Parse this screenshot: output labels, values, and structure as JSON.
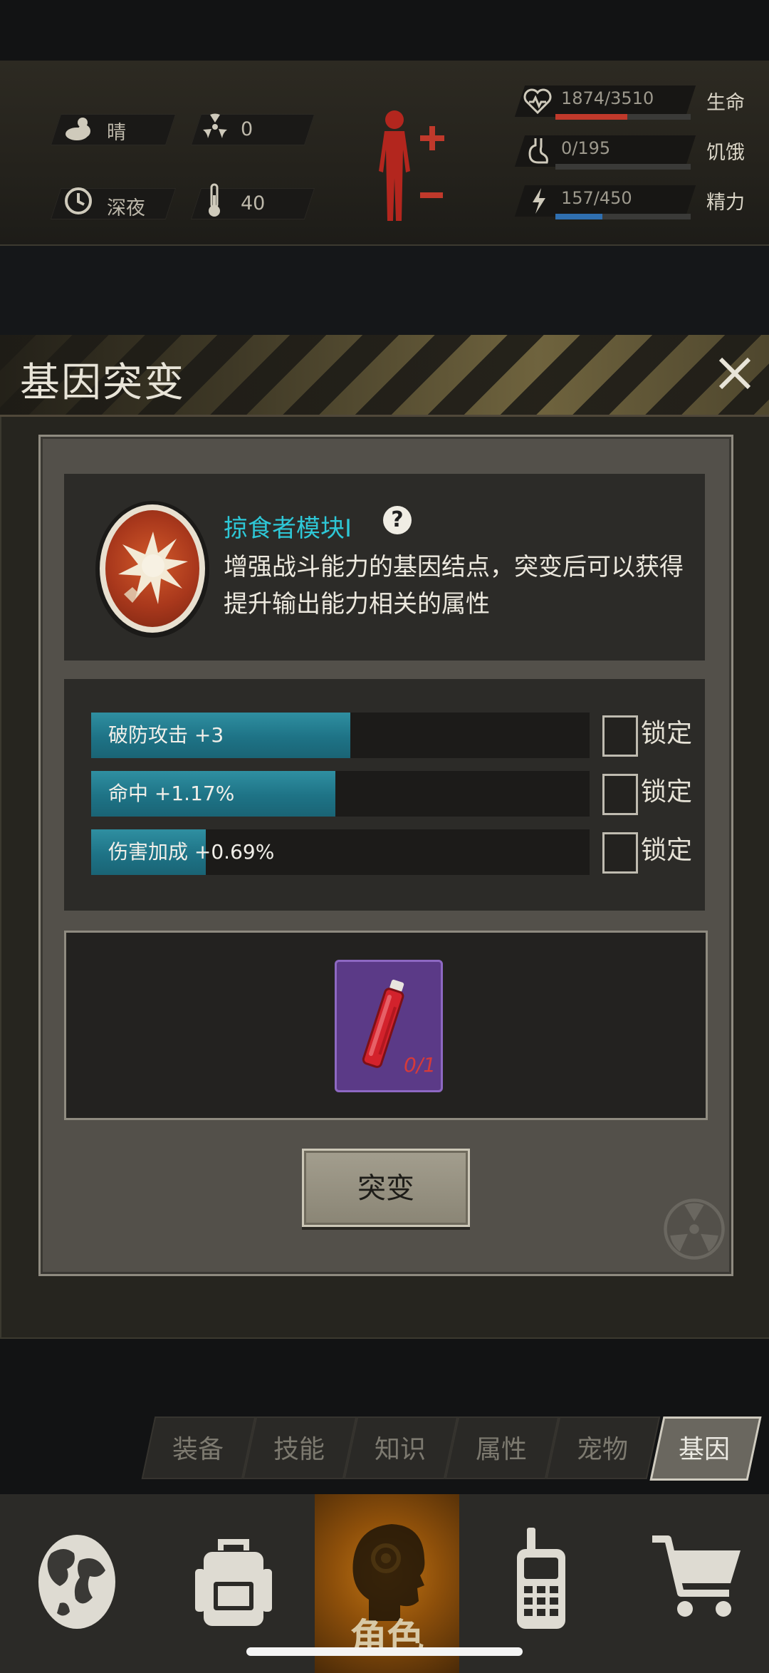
{
  "status": {
    "weather": {
      "icon": "cloud-sun-icon",
      "value": "晴"
    },
    "radiation": {
      "icon": "radiation-icon",
      "value": "0"
    },
    "time": {
      "icon": "clock-icon",
      "value": "深夜"
    },
    "temperature": {
      "icon": "thermometer-icon",
      "value": "40"
    }
  },
  "vitals": [
    {
      "name": "life",
      "label": "生命",
      "value": "1874/3510",
      "fraction": 0.534,
      "color": "#c0392b",
      "icon": "heart-icon"
    },
    {
      "name": "hunger",
      "label": "饥饿",
      "value": "0/195",
      "fraction": 0.0,
      "color": "#8a8a86",
      "icon": "stomach-icon"
    },
    {
      "name": "energy",
      "label": "精力",
      "value": "157/450",
      "fraction": 0.349,
      "color": "#2f6fb0",
      "icon": "energy-icon"
    }
  ],
  "modal": {
    "title": "基因突变",
    "node_name": "掠食者模块Ⅰ",
    "description": "增强战斗能力的基因结点，突变后可以获得提升输出能力相关的属性",
    "attributes": [
      {
        "label": "破防攻击 +3",
        "fraction": 0.52,
        "lock_label": "锁定"
      },
      {
        "label": "命中 +1.17%",
        "fraction": 0.49,
        "lock_label": "锁定"
      },
      {
        "label": "伤害加成 +0.69%",
        "fraction": 0.23,
        "lock_label": "锁定"
      }
    ],
    "item": {
      "count": "0/1",
      "icon": "serum-vial-icon"
    },
    "mutate_label": "突变"
  },
  "tabs": [
    "装备",
    "技能",
    "知识",
    "属性",
    "宠物",
    "基因"
  ],
  "active_tab": "基因",
  "nav": {
    "items": [
      {
        "name": "world",
        "icon": "globe-icon"
      },
      {
        "name": "inventory",
        "icon": "backpack-icon"
      },
      {
        "name": "character",
        "icon": "head-profile-icon",
        "label": "角色"
      },
      {
        "name": "radio",
        "icon": "walkie-talkie-icon"
      },
      {
        "name": "shop",
        "icon": "cart-icon"
      }
    ]
  },
  "colors": {
    "accent_cyan": "#2ec7d6",
    "bar_fill": "#1e7386",
    "item_purple": "#5b3a87"
  }
}
